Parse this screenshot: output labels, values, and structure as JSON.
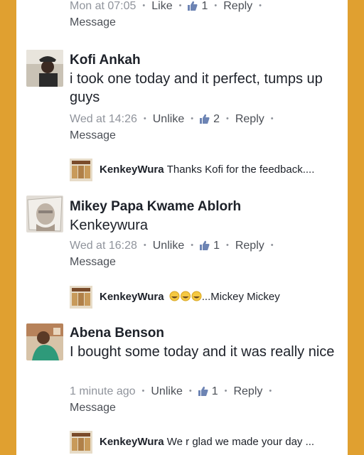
{
  "colors": {
    "frame": "#e0a030",
    "meta_gray": "#90949c",
    "action_gray": "#4b4f56",
    "name_text": "#1d2129"
  },
  "top_partial": {
    "time": "Mon at 07:05",
    "like": "Like",
    "likes": "1",
    "reply": "Reply",
    "message": "Message"
  },
  "comments": [
    {
      "name": "Kofi Ankah",
      "text": "i took one today and it perfect, tumps up guys",
      "time": "Wed at 14:26",
      "like": "Unlike",
      "likes": "2",
      "reply": "Reply",
      "message": "Message",
      "reply_item": {
        "name": "KenkeyWura",
        "text": "Thanks Kofi for the feedback...."
      }
    },
    {
      "name": "Mikey Papa Kwame Ablorh",
      "text": "Kenkeywura",
      "time": "Wed at 16:28",
      "like": "Unlike",
      "likes": "1",
      "reply": "Reply",
      "message": "Message",
      "reply_item": {
        "name": "KenkeyWura",
        "text": "...Mickey Mickey"
      }
    },
    {
      "name": "Abena Benson",
      "text": "I bought some today and it was really nice",
      "time": "1 minute ago",
      "like": "Unlike",
      "likes": "1",
      "reply": "Reply",
      "message": "Message",
      "reply_item": {
        "name": "KenkeyWura",
        "text": "We r glad we made your day ..."
      }
    }
  ],
  "icons": {
    "like": "thumbs-up-icon",
    "emoji": "grinning-face-icon"
  }
}
